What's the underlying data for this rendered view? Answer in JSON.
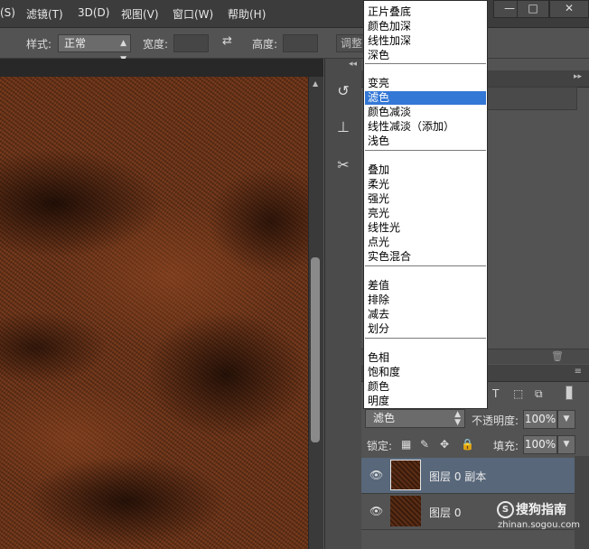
{
  "menubar": {
    "items": [
      "(S)",
      "滤镜(T)",
      "3D(D)",
      "视图(V)",
      "窗口(W)",
      "帮助(H)"
    ],
    "window_controls": [
      "—",
      "□",
      "✕"
    ]
  },
  "options_bar": {
    "style_label": "样式:",
    "style_value": "正常",
    "width_label": "宽度:",
    "height_label": "高度:",
    "refine_button": "调整"
  },
  "blend_dropdown": {
    "groups": [
      [
        "正片叠底",
        "颜色加深",
        "线性加深",
        "深色"
      ],
      [
        "变亮",
        "滤色",
        "颜色减淡",
        "线性减淡（添加）",
        "浅色"
      ],
      [
        "叠加",
        "柔光",
        "强光",
        "亮光",
        "线性光",
        "点光",
        "实色混合"
      ],
      [
        "差值",
        "排除",
        "减去",
        "划分"
      ],
      [
        "色相",
        "饱和度",
        "颜色",
        "明度"
      ]
    ],
    "selected": "滤色"
  },
  "layers_panel": {
    "blend_mode": "滤色",
    "opacity_label": "不透明度:",
    "opacity_value": "100%",
    "lock_label": "锁定:",
    "fill_label": "填充:",
    "fill_value": "100%",
    "layers": [
      {
        "name": "图层 0 副本",
        "visible": true,
        "selected": true
      },
      {
        "name": "图层 0",
        "visible": true,
        "selected": false
      }
    ]
  },
  "watermark": {
    "logo_letter": "S",
    "text": "搜狗指南",
    "url": "zhinan.sogou.com"
  },
  "colors": {
    "selection": "#3478d6",
    "selected_layer_row": "#58677a",
    "texture_base": "#6b3419"
  },
  "icons": [
    "history-icon",
    "clone-source-icon",
    "tool-preset-icon",
    "eye-icon",
    "lock-icon",
    "trash-icon"
  ]
}
